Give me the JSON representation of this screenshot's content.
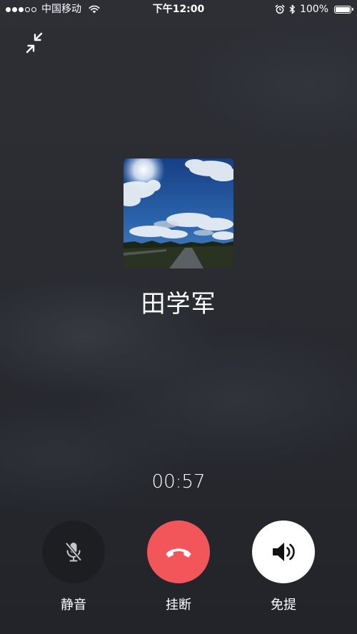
{
  "status_bar": {
    "carrier": "中国移动",
    "time": "下午12:00",
    "battery": "100%",
    "signal_bars_filled": 3,
    "signal_bars_total": 5,
    "icons": [
      "wifi-icon",
      "alarm-icon",
      "bluetooth-icon",
      "battery-icon"
    ]
  },
  "call": {
    "caller_name": "田学军",
    "duration": "00:57",
    "avatar": "landscape-photo"
  },
  "controls": {
    "mute_label": "静音",
    "hangup_label": "挂断",
    "speaker_label": "免提"
  },
  "colors": {
    "background": "#2a2c32",
    "hangup": "#f2555a",
    "mute_circle": "#1d1e21",
    "speaker_circle": "#ffffff"
  }
}
